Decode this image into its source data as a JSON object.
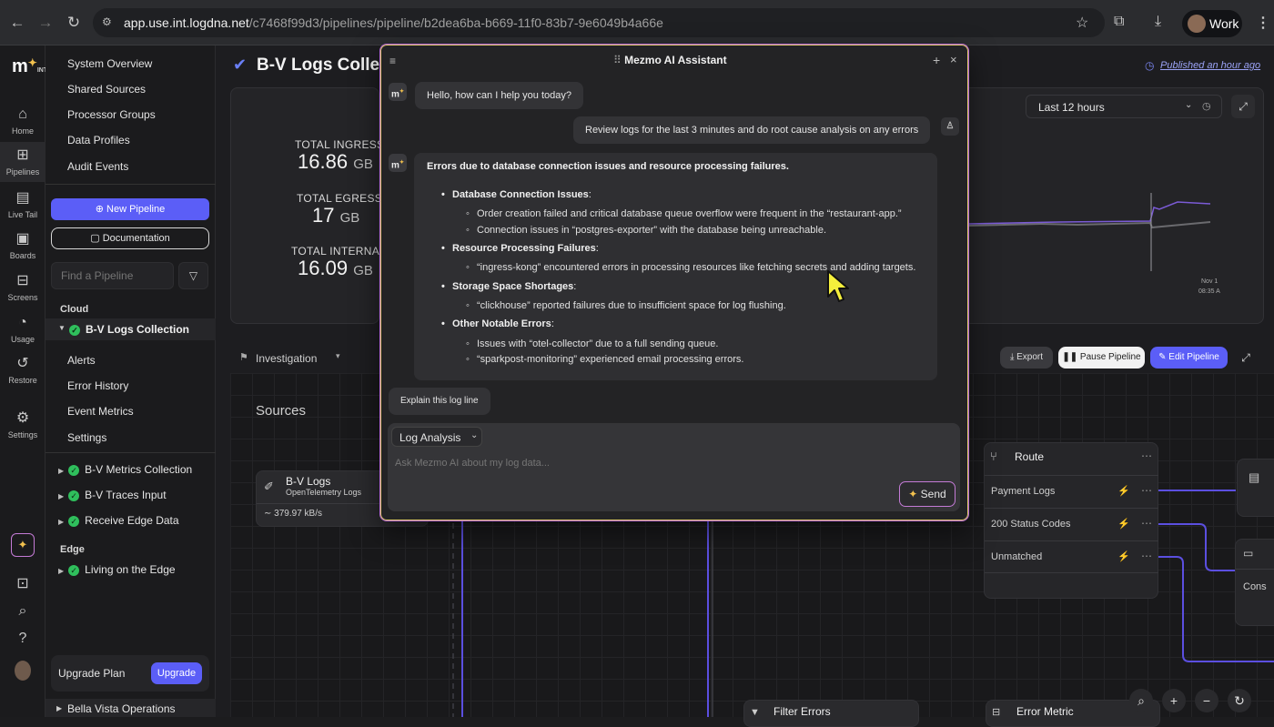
{
  "browser": {
    "url_host": "app.use.int.logdna.net",
    "url_path": "/c7468f99d3/pipelines/pipeline/b2dea6ba-b669-11f0-83b7-9e6049b4a66e",
    "profile": "Work"
  },
  "rail": {
    "logo": "m",
    "logo_sub": "INT",
    "items": [
      {
        "label": "Home",
        "icon": "home-icon"
      },
      {
        "label": "Pipelines",
        "icon": "pipelines-icon"
      },
      {
        "label": "Live Tail",
        "icon": "live-tail-icon"
      },
      {
        "label": "Boards",
        "icon": "boards-icon"
      },
      {
        "label": "Screens",
        "icon": "screens-icon"
      },
      {
        "label": "Usage",
        "icon": "usage-icon"
      },
      {
        "label": "Restore",
        "icon": "restore-icon"
      },
      {
        "label": "Settings",
        "icon": "settings-icon"
      }
    ]
  },
  "nav": {
    "top_links": [
      "System Overview",
      "Shared Sources",
      "Processor Groups",
      "Data Profiles",
      "Audit Events"
    ],
    "new_pipeline": "New Pipeline",
    "documentation": "Documentation",
    "find_placeholder": "Find a Pipeline",
    "cloud_label": "Cloud",
    "selected_pipeline": "B-V Logs Collection",
    "sub_items": [
      "Alerts",
      "Error History",
      "Event Metrics",
      "Settings"
    ],
    "cloud_pipelines": [
      "B-V Metrics Collection",
      "B-V Traces Input",
      "Receive Edge Data"
    ],
    "edge_label": "Edge",
    "edge_pipelines": [
      "Living on the Edge"
    ],
    "upgrade_text": "Upgrade Plan",
    "upgrade_button": "Upgrade",
    "org_item": "Bella Vista Operations"
  },
  "main": {
    "title": "B-V Logs Collec",
    "published": "Published an hour ago",
    "stats": [
      {
        "label": "TOTAL INGRESS",
        "value": "16.86",
        "unit": "GB"
      },
      {
        "label": "TOTAL EGRESS",
        "value": "17",
        "unit": "GB"
      },
      {
        "label": "TOTAL INTERNAL",
        "value": "16.09",
        "unit": "GB"
      }
    ],
    "time_range": "Last 12 hours",
    "chart_tick_1": "Nov 1",
    "chart_tick_2": "08:35 A",
    "investigation": "Investigation",
    "export": "Export",
    "pause": "Pause Pipeline",
    "edit": "Edit Pipeline",
    "sources_label": "Sources",
    "source_node": {
      "title": "B-V Logs",
      "subtitle": "OpenTelemetry Logs",
      "rate": "379.97 kB/s"
    },
    "route": {
      "title": "Route",
      "rows": [
        "Payment Logs",
        "200 Status Codes",
        "Unmatched"
      ]
    },
    "filter_node": "Filter Errors",
    "metric_node": "Error Metric",
    "right_node_text": "Cons"
  },
  "chat": {
    "title": "Mezmo AI Assistant",
    "greeting": "Hello, how can I help you today?",
    "user_msg": "Review logs for the last 3 minutes and do root cause analysis on any errors",
    "response_heading": "Errors due to database connection issues and resource processing failures.",
    "sections": [
      {
        "title": "Database Connection Issues",
        "items": [
          "Order creation failed and critical database queue overflow were frequent in the “restaurant-app.”",
          "Connection issues in “postgres-exporter” with the database being unreachable."
        ]
      },
      {
        "title": "Resource Processing Failures",
        "items": [
          "“ingress-kong” encountered errors in processing resources like fetching secrets and adding targets."
        ]
      },
      {
        "title": "Storage Space Shortages",
        "items": [
          "“clickhouse” reported failures due to insufficient space for log flushing."
        ]
      },
      {
        "title": "Other Notable Errors",
        "items": [
          "Issues with “otel-collector” due to a full sending queue.",
          "“sparkpost-monitoring” experienced email processing errors."
        ]
      }
    ],
    "suggestion": "Explain this log line",
    "mode": "Log Analysis",
    "input_placeholder": "Ask Mezmo AI about my log data...",
    "send": "Send",
    "avatar": "m"
  }
}
